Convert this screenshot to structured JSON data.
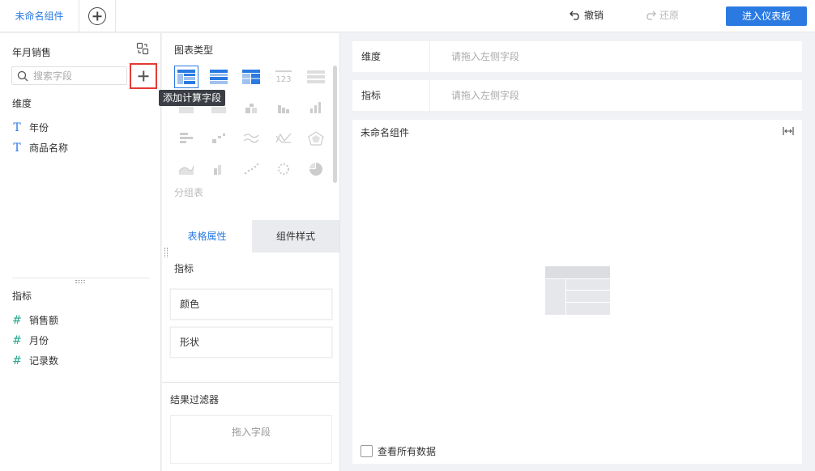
{
  "header": {
    "tab_label": "未命名组件",
    "undo_label": "撤销",
    "redo_label": "还原",
    "enter_dashboard_label": "进入仪表板"
  },
  "left": {
    "dataset_name": "年月销售",
    "search_placeholder": "搜索字段",
    "tooltip": "添加计算字段",
    "dimension_section": "维度",
    "dimension_fields": [
      "年份",
      "商品名称"
    ],
    "measure_section": "指标",
    "measure_fields": [
      "销售额",
      "月份",
      "记录数"
    ]
  },
  "middle": {
    "chart_type_title": "图表类型",
    "selected_chart": "分组表",
    "group_label": "分组表",
    "tabs": [
      "表格属性",
      "组件样式"
    ],
    "measure_label": "指标",
    "color_label": "颜色",
    "shape_label": "形状",
    "filter_label": "结果过滤器",
    "drop_field_label": "拖入字段"
  },
  "right": {
    "dimension_label": "维度",
    "dimension_placeholder": "请拖入左侧字段",
    "measure_label": "指标",
    "measure_placeholder": "请拖入左侧字段",
    "widget_title": "未命名组件",
    "view_all_label": "查看所有数据"
  },
  "colors": {
    "accent": "#2a7ae2",
    "highlight_border": "#e53935",
    "measure_icon": "#23a78c"
  }
}
